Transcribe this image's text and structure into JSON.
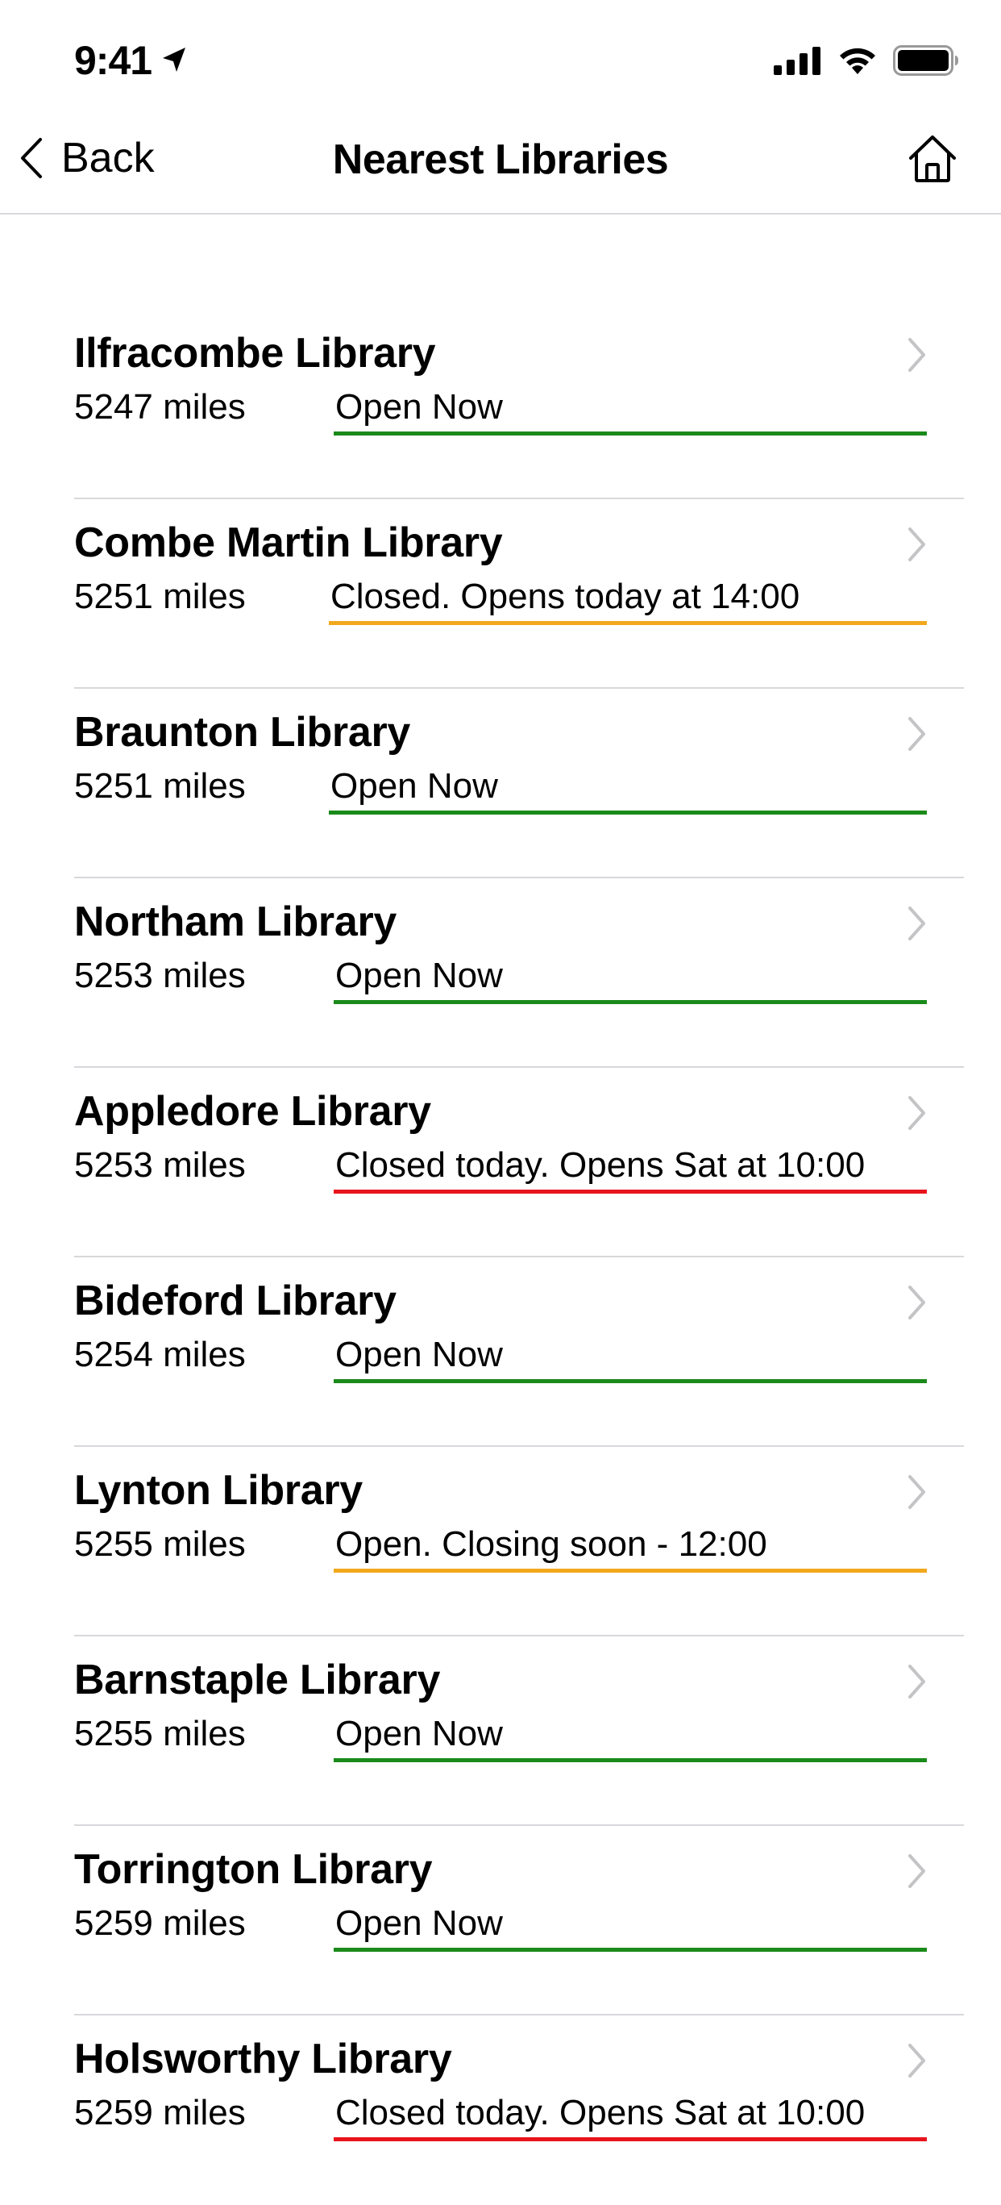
{
  "status_bar": {
    "time": "9:41"
  },
  "nav": {
    "back_label": "Back",
    "title": "Nearest Libraries"
  },
  "colors": {
    "open": "#1a8a1a",
    "warning": "#f2a81d",
    "closed": "#e8141c",
    "chevron": "#c4c4c7",
    "divider": "#d8d8dc"
  },
  "libraries": [
    {
      "name": "Ilfracombe Library",
      "distance": "5247 miles",
      "status": "Open Now",
      "status_color": "green"
    },
    {
      "name": "Combe Martin Library",
      "distance": "5251 miles",
      "status": "Closed. Opens today at 14:00",
      "status_color": "amber"
    },
    {
      "name": "Braunton Library",
      "distance": "5251 miles",
      "status": "Open Now",
      "status_color": "green"
    },
    {
      "name": "Northam Library",
      "distance": "5253 miles",
      "status": "Open Now",
      "status_color": "green"
    },
    {
      "name": "Appledore Library",
      "distance": "5253 miles",
      "status": "Closed today. Opens Sat at 10:00",
      "status_color": "red"
    },
    {
      "name": "Bideford Library",
      "distance": "5254 miles",
      "status": "Open Now",
      "status_color": "green"
    },
    {
      "name": "Lynton Library",
      "distance": "5255 miles",
      "status": "Open. Closing soon - 12:00",
      "status_color": "amber"
    },
    {
      "name": "Barnstaple Library",
      "distance": "5255 miles",
      "status": "Open Now",
      "status_color": "green"
    },
    {
      "name": "Torrington Library",
      "distance": "5259 miles",
      "status": "Open Now",
      "status_color": "green"
    },
    {
      "name": "Holsworthy Library",
      "distance": "5259 miles",
      "status": "Closed today. Opens Sat at 10:00",
      "status_color": "red"
    }
  ]
}
